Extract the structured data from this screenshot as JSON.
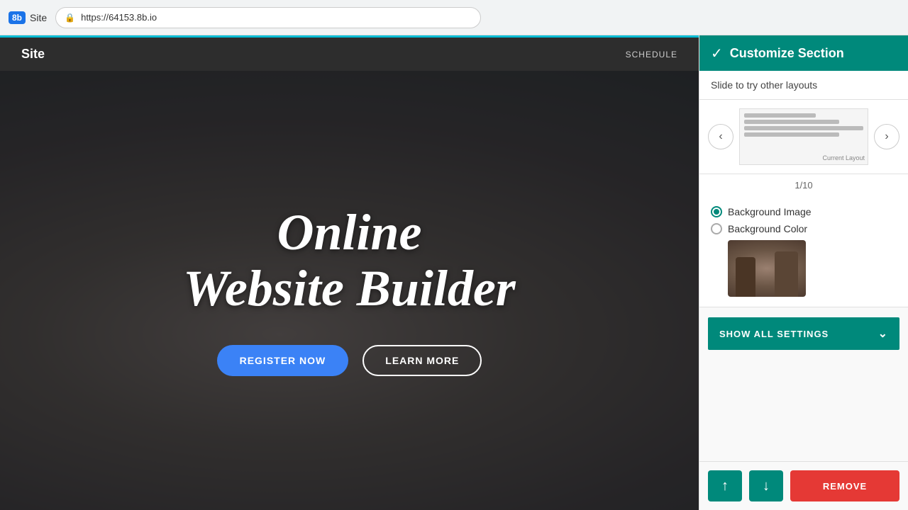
{
  "browser": {
    "logo_text": "8b",
    "site_label": "Site",
    "url": "https://64153.8b.io"
  },
  "site_nav": {
    "title": "Site",
    "links": [
      "SCHEDULE"
    ]
  },
  "hero": {
    "title_line1": "Online",
    "title_line2": "Website Builder",
    "btn_register": "REGISTER NOW",
    "btn_learn": "LEARN MORE"
  },
  "panel": {
    "header_title": "Customize Section",
    "slide_hint": "Slide to try other layouts",
    "layout_label": "Current\nLayout",
    "pagination": "1/10",
    "bg_image_label": "Background Image",
    "bg_color_label": "Background Color",
    "show_all_label": "SHOW ALL SETTINGS",
    "remove_label": "REMOVE"
  }
}
